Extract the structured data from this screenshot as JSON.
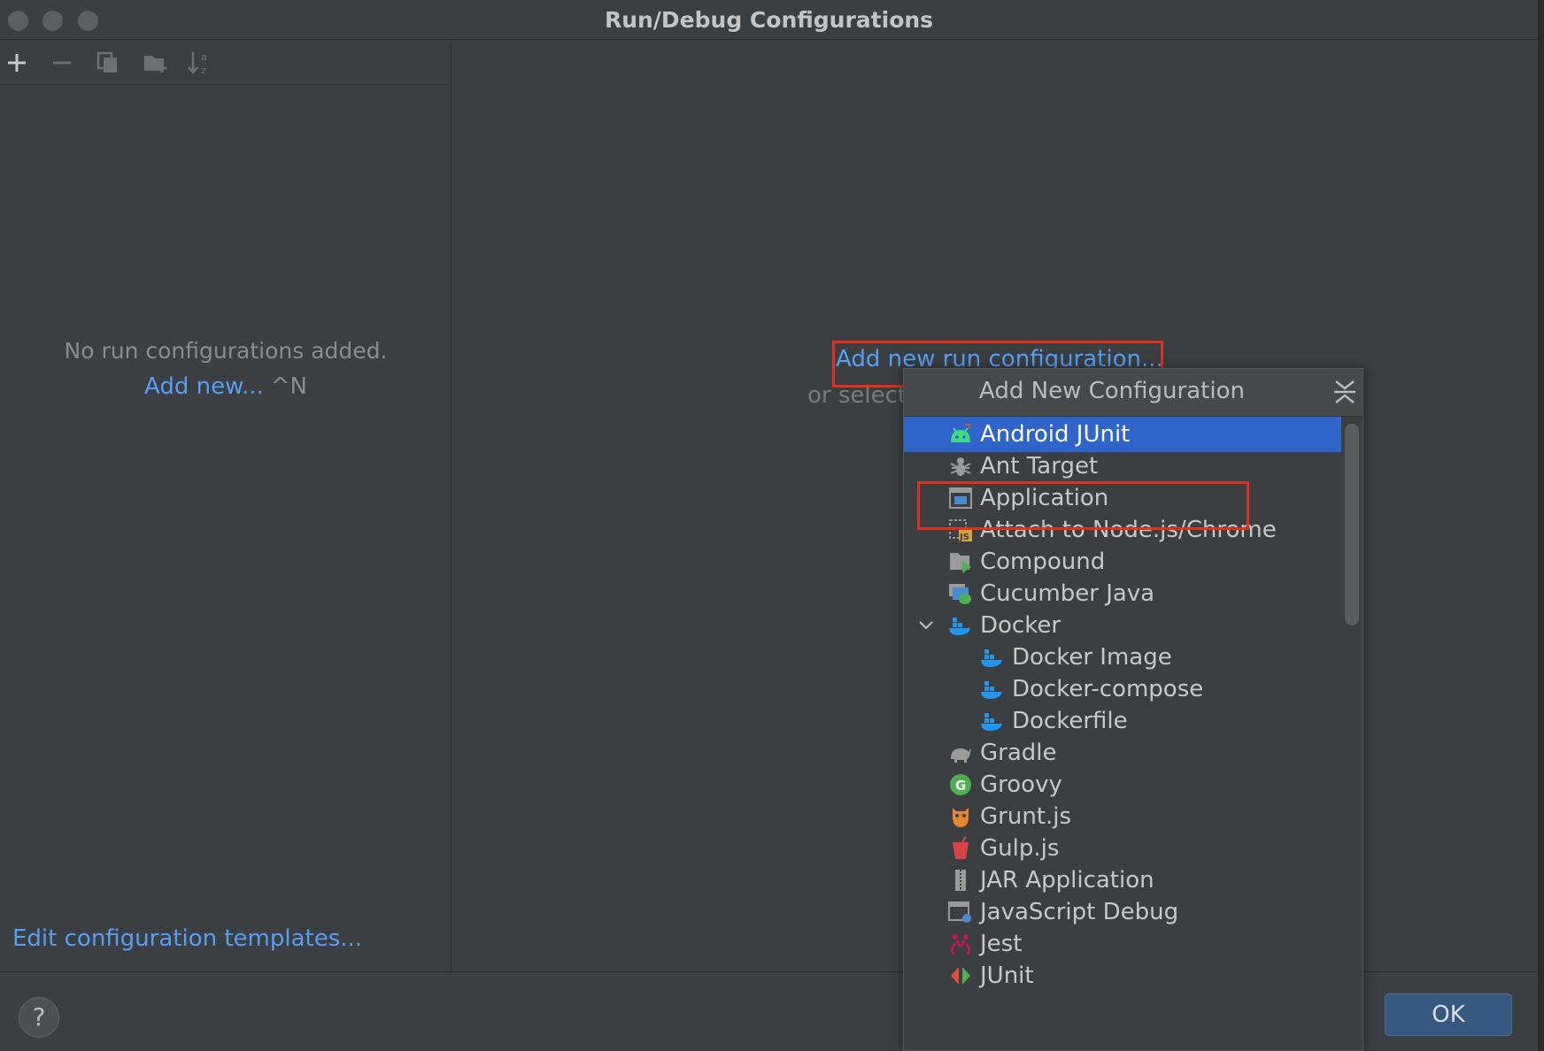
{
  "window": {
    "title": "Run/Debug Configurations"
  },
  "left_pane": {
    "empty_message": "No run configurations added.",
    "add_new_label": "Add new...",
    "add_new_shortcut": "^N",
    "templates_link": "Edit configuration templates..."
  },
  "main": {
    "add_run_config": "Add new run configuration...",
    "or_select": "or select"
  },
  "popup": {
    "title": "Add New Configuration",
    "items": [
      {
        "label": "Android JUnit",
        "icon": "android-icon",
        "selected": true
      },
      {
        "label": "Ant Target",
        "icon": "ant-icon"
      },
      {
        "label": "Application",
        "icon": "application-window-icon"
      },
      {
        "label": "Attach to Node.js/Chrome",
        "icon": "attach-nodejs-icon"
      },
      {
        "label": "Compound",
        "icon": "compound-folder-icon"
      },
      {
        "label": "Cucumber Java",
        "icon": "cucumber-icon"
      },
      {
        "label": "Docker",
        "icon": "docker-icon",
        "expanded": true
      },
      {
        "label": "Docker Image",
        "icon": "docker-icon"
      },
      {
        "label": "Docker-compose",
        "icon": "docker-icon"
      },
      {
        "label": "Dockerfile",
        "icon": "docker-icon"
      },
      {
        "label": "Gradle",
        "icon": "gradle-elephant-icon"
      },
      {
        "label": "Groovy",
        "icon": "groovy-icon"
      },
      {
        "label": "Grunt.js",
        "icon": "grunt-icon"
      },
      {
        "label": "Gulp.js",
        "icon": "gulp-cup-icon"
      },
      {
        "label": "JAR Application",
        "icon": "jar-icon"
      },
      {
        "label": "JavaScript Debug",
        "icon": "javascript-debug-icon"
      },
      {
        "label": "Jest",
        "icon": "jest-icon"
      },
      {
        "label": "JUnit",
        "icon": "junit-icon"
      }
    ]
  },
  "footer": {
    "help_label": "?",
    "ok_label": "OK"
  },
  "colors": {
    "background": "#3c3f41",
    "link": "#589df6",
    "selection": "#2f65ca",
    "highlight_box": "#e0301e",
    "ok_button": "#365880"
  }
}
